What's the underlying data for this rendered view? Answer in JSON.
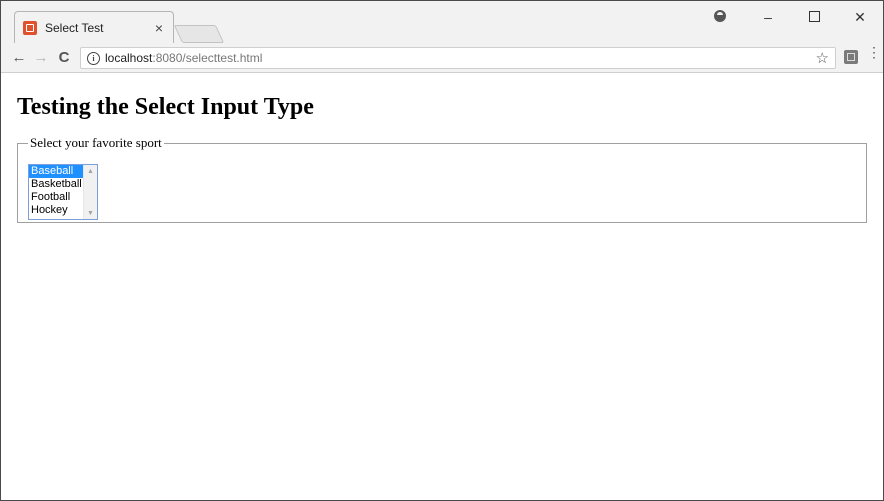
{
  "browser": {
    "tab_title": "Select Test",
    "tab_close": "×",
    "url_host": "localhost",
    "url_rest": ":8080/selecttest.html",
    "back": "←",
    "forward": "→",
    "reload": "C",
    "info": "i",
    "star": "☆",
    "menu": "⋮",
    "minimize": "–",
    "close": "✕"
  },
  "page": {
    "heading": "Testing the Select Input Type",
    "legend": "Select your favorite sport",
    "options": [
      "Baseball",
      "Basketball",
      "Football",
      "Hockey"
    ],
    "selected": "Baseball",
    "scroll_up": "▲",
    "scroll_down": "▼"
  },
  "colors": {
    "selected_bg": "#1e90ff",
    "favicon": "#e0522b"
  }
}
